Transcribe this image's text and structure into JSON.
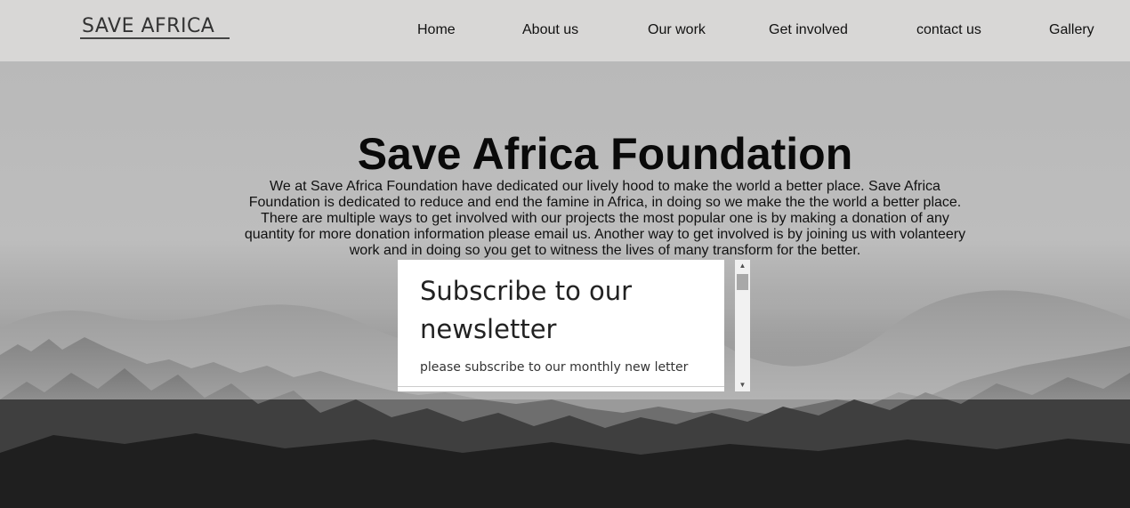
{
  "header": {
    "logo_text": "SAVE AFRICA",
    "nav": [
      "Home",
      "About us",
      "Our work",
      "Get involved",
      "contact us",
      "Gallery"
    ]
  },
  "hero": {
    "title": "Save Africa Foundation",
    "intro": "We at Save Africa Foundation have dedicated our lively hood to make the world a better place. Save Africa Foundation is dedicated to reduce and end the famine in Africa, in doing so we make the the world a better place. There are multiple ways to get involved with our projects the most popular one is by making a donation of any quantity for more donation information please email us. Another way to get involved is by joining us with volanteery work and in doing so you get to witness the lives of many transform for the better."
  },
  "newsletter": {
    "heading": "Subscribe to our newsletter",
    "subtext": "please subscribe to our monthly new letter"
  },
  "scrollbar": {
    "up_icon": "chevron-up-icon",
    "down_icon": "chevron-down-icon"
  }
}
